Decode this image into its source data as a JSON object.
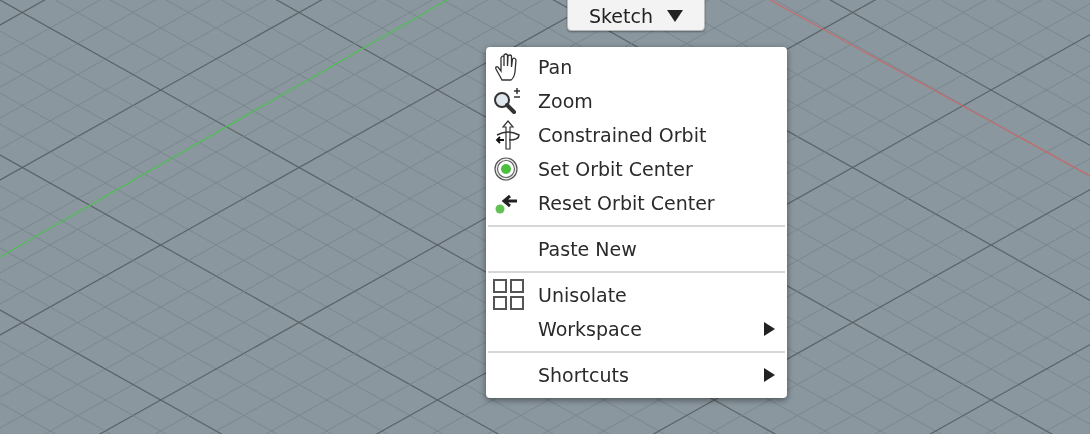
{
  "toolbar": {
    "label": "Sketch"
  },
  "menu": {
    "sections": [
      {
        "items": [
          {
            "label": "Pan",
            "submenu": false
          },
          {
            "label": "Zoom",
            "submenu": false
          },
          {
            "label": "Constrained Orbit",
            "submenu": false
          },
          {
            "label": "Set Orbit Center",
            "submenu": false
          },
          {
            "label": "Reset Orbit Center",
            "submenu": false
          }
        ]
      },
      {
        "items": [
          {
            "label": "Paste New",
            "submenu": false
          }
        ]
      },
      {
        "items": [
          {
            "label": "Unisolate",
            "submenu": false
          },
          {
            "label": "Workspace",
            "submenu": true
          }
        ]
      },
      {
        "items": [
          {
            "label": "Shortcuts",
            "submenu": true
          }
        ]
      }
    ]
  }
}
